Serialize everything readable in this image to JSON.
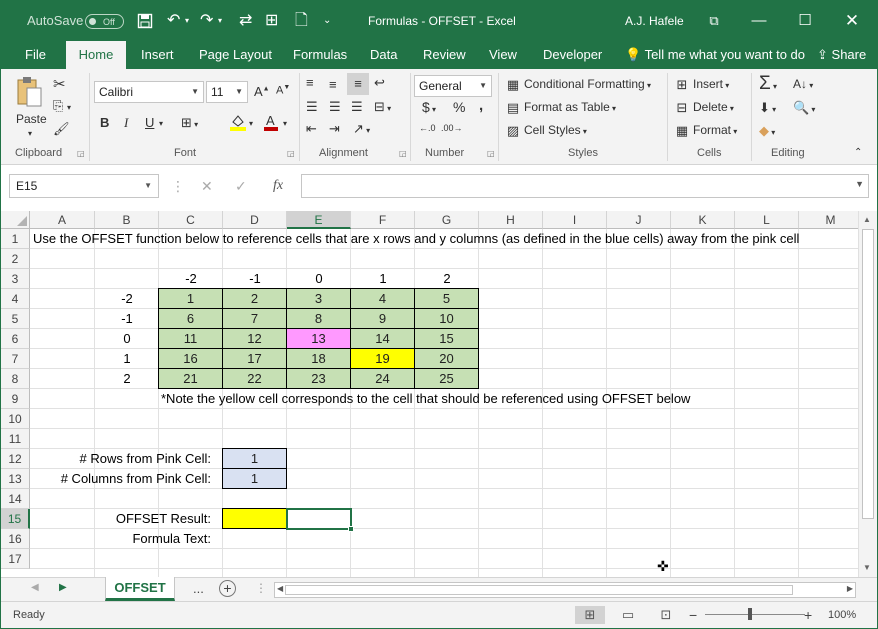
{
  "app": {
    "autosave_label": "AutoSave",
    "autosave_state": "Off",
    "title": "Formulas - OFFSET  -  Excel",
    "user": "A.J. Hafele",
    "accent_color": "#217346"
  },
  "ribbon_tabs": [
    "File",
    "Home",
    "Insert",
    "Page Layout",
    "Formulas",
    "Data",
    "Review",
    "View",
    "Developer"
  ],
  "tell_me": "Tell me what you want to do",
  "share": "Share",
  "ribbon": {
    "clipboard": {
      "paste": "Paste",
      "label": "Clipboard"
    },
    "font": {
      "name": "Calibri",
      "size": "11",
      "bold": "B",
      "italic": "I",
      "underline": "U",
      "label": "Font"
    },
    "alignment": {
      "label": "Alignment"
    },
    "number": {
      "format": "General",
      "currency": "$",
      "percent": "%",
      "comma": ",",
      "label": "Number"
    },
    "styles": {
      "conditional": "Conditional Formatting",
      "table": "Format as Table",
      "cell_styles": "Cell Styles",
      "label": "Styles"
    },
    "cells": {
      "insert": "Insert",
      "delete": "Delete",
      "format": "Format",
      "label": "Cells"
    },
    "editing": {
      "label": "Editing"
    }
  },
  "formula_bar": {
    "name_box": "E15",
    "fx": "fx",
    "content": ""
  },
  "columns": [
    "A",
    "B",
    "C",
    "D",
    "E",
    "F",
    "G",
    "H",
    "I",
    "J",
    "K",
    "L",
    "M"
  ],
  "rows": [
    "1",
    "2",
    "3",
    "4",
    "5",
    "6",
    "7",
    "8",
    "9",
    "10",
    "11",
    "12",
    "13",
    "14",
    "15",
    "16",
    "17"
  ],
  "sheet": {
    "a1": "Use the OFFSET function below to reference cells that are x rows and y columns (as defined in the blue cells) away from the pink cell",
    "col_offsets": [
      "-2",
      "-1",
      "0",
      "1",
      "2"
    ],
    "row_offsets": [
      "-2",
      "-1",
      "0",
      "1",
      "2"
    ],
    "grid": [
      [
        "1",
        "2",
        "3",
        "4",
        "5"
      ],
      [
        "6",
        "7",
        "8",
        "9",
        "10"
      ],
      [
        "11",
        "12",
        "13",
        "14",
        "15"
      ],
      [
        "16",
        "17",
        "18",
        "19",
        "20"
      ],
      [
        "21",
        "22",
        "23",
        "24",
        "25"
      ]
    ],
    "note": "*Note the yellow cell corresponds to the cell that should be referenced using OFFSET below",
    "rows_label": "# Rows from Pink Cell:",
    "rows_value": "1",
    "cols_label": "# Columns from Pink Cell:",
    "cols_value": "1",
    "result_label": "OFFSET Result:",
    "formula_label": "Formula Text:",
    "colors": {
      "green": "#c6e0b4",
      "pink": "#ff99ff",
      "yellow": "#ffff00",
      "blue": "#d9e1f2"
    }
  },
  "sheet_tabs": {
    "active": "OFFSET",
    "more": "..."
  },
  "status": {
    "ready": "Ready",
    "zoom": "100%"
  }
}
